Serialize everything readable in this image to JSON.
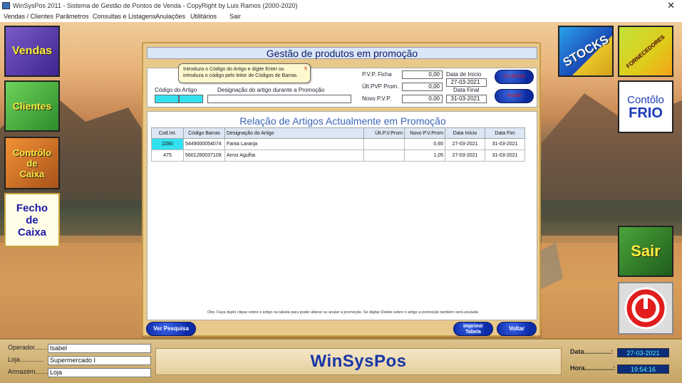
{
  "window": {
    "title": "WinSysPos 2011 - Sistema de Gestão de Pontos de Venda - CopyRight by Luis Ramos (2000-2020)",
    "close_glyph": "✕"
  },
  "menu": {
    "items": [
      "Vendas / Clientes",
      "Parâmetros",
      "Consultas e Listagens",
      "Anulações",
      "Utilitários",
      "Sair"
    ]
  },
  "tiles": {
    "vendas": "Vendas",
    "clientes": "Clientes",
    "controlo_caixa": [
      "Contrôlo",
      "de",
      "Caixa"
    ],
    "fecho_caixa": [
      "Fecho",
      "de",
      "Caixa"
    ],
    "stocks": "STOCKS",
    "fornecedores": "FORNECEDORES",
    "controlo_frio": [
      "Contôlo",
      "FRIO"
    ],
    "sair": "Sair"
  },
  "panel": {
    "title": "Gestão de produtos em promoção",
    "tooltip": {
      "text": "Introduza o Código do Artigo e digite Enter ou introduza o código pelo leitor de Códigos de Barras.",
      "close": "x"
    },
    "labels": {
      "codigo_artigo": "Código do Artigo",
      "designacao": "Designação do artigo durante a Promoção",
      "pvp_ficha": "P.V.P. Ficha",
      "ult_pvp_prom": "Últ.PVP Prom.",
      "novo_pvp": "Novo P.V.P.",
      "data_inicio": "Data de Início",
      "data_final": "Data Final"
    },
    "values": {
      "pvp_ficha": "0,00",
      "ult_pvp_prom": "0,00",
      "novo_pvp": "0,00",
      "data_inicio": "27-03-2021",
      "data_final": "31-03-2021"
    },
    "buttons": {
      "confirmar": "Confirmar",
      "anular": "Anular"
    }
  },
  "list": {
    "title": "Relação de Artigos Actualmente em Promoção",
    "columns": [
      "Cod.Int.",
      "Código Barras",
      "Designação do Artigo",
      "Últ.P.V.Prom",
      "Novo P.V.Prom",
      "Data Início",
      "Data Fim"
    ],
    "rows": [
      [
        "2280",
        "5449000054074",
        "Fanta Laranja",
        "",
        "0,65",
        "27-03-2021",
        "31-03-2021"
      ],
      [
        "475",
        "5601260037109",
        "Arroz Agulha",
        "",
        "1,05",
        "27-03-2021",
        "31-03-2021"
      ]
    ],
    "obs": "Obs: Faça duplo clique sobre o artigo na tabela para poder alterar ou anular a promoção. Se digitar Delete sobre o artigo a promoção também será anulada"
  },
  "actions": {
    "ver_pesquisa": "Ver Pesquisa",
    "imprimir_tabela": [
      "Imprimir",
      "Tabela"
    ],
    "voltar": "Voltar"
  },
  "status": {
    "operador_label": "Operador.......",
    "operador": "Isabel",
    "loja_label": "Loja.............",
    "loja": "Supermercado I",
    "armazem_label": "Armazém.......",
    "armazem": "Loja",
    "brand": "WinSysPos",
    "data_label": "Data...............:",
    "data": "27-03-2021",
    "hora_label": "Hora................:",
    "hora": "19:54:16"
  },
  "colors": {
    "accent_blue": "#1736a8",
    "cell_highlight": "#33e0f0",
    "panel_bg": "#e9c98b"
  }
}
